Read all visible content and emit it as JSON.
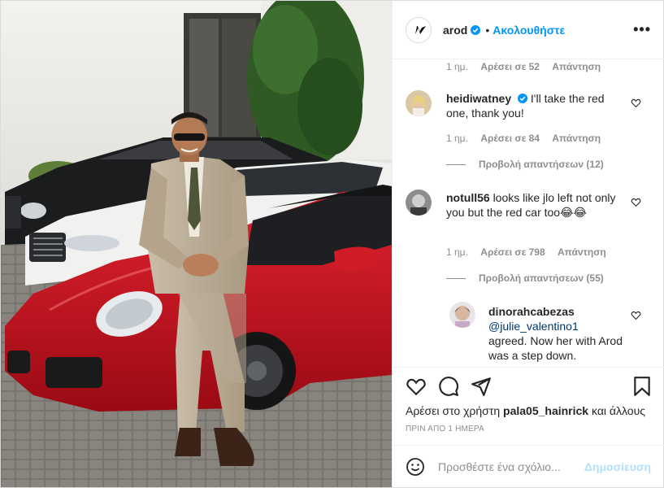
{
  "post": {
    "username": "arod",
    "follow_label": "Ακολουθήστε",
    "separator": "•",
    "more_label": "•••"
  },
  "top_meta": {
    "time": "1 ημ.",
    "likes": "Αρέσει σε 52",
    "reply": "Απάντηση"
  },
  "comments": [
    {
      "username": "heidiwatney",
      "verified": true,
      "text": "I'll take the red one, thank you!",
      "time": "1 ημ.",
      "likes": "Αρέσει σε 84",
      "reply": "Απάντηση",
      "view_replies": "Προβολή απαντήσεων (12)"
    },
    {
      "username": "notull56",
      "verified": false,
      "text": "looks like jlo left not only you but the red car too😂😂",
      "time": "1 ημ.",
      "likes": "Αρέσει σε 798",
      "reply": "Απάντηση",
      "view_replies": "Προβολή απαντήσεων (55)"
    }
  ],
  "reply": {
    "username": "dinorahcabezas",
    "mention": "@julie_valentino1",
    "text": "agreed. Now her with Arod was a step down."
  },
  "likes_line": {
    "prefix": "Αρέσει στο χρήστη",
    "user": "pala05_hainrick",
    "suffix": "και άλλους"
  },
  "timestamp": "ΠΡΙΝ ΑΠΟ 1 ΗΜΕΡΑ",
  "add_comment": {
    "placeholder": "Προσθέστε ένα σχόλιο...",
    "post_label": "Δημοσίευση"
  },
  "icons": [
    "heart-icon",
    "comment-icon",
    "share-icon",
    "bookmark-icon",
    "emoji-icon",
    "verified-icon",
    "more-icon"
  ],
  "colors": {
    "accent": "#0095f6",
    "link": "#00376b",
    "muted": "#8e8e8e",
    "post_disabled": "#b2dffc",
    "car_red": "#c8101e"
  }
}
